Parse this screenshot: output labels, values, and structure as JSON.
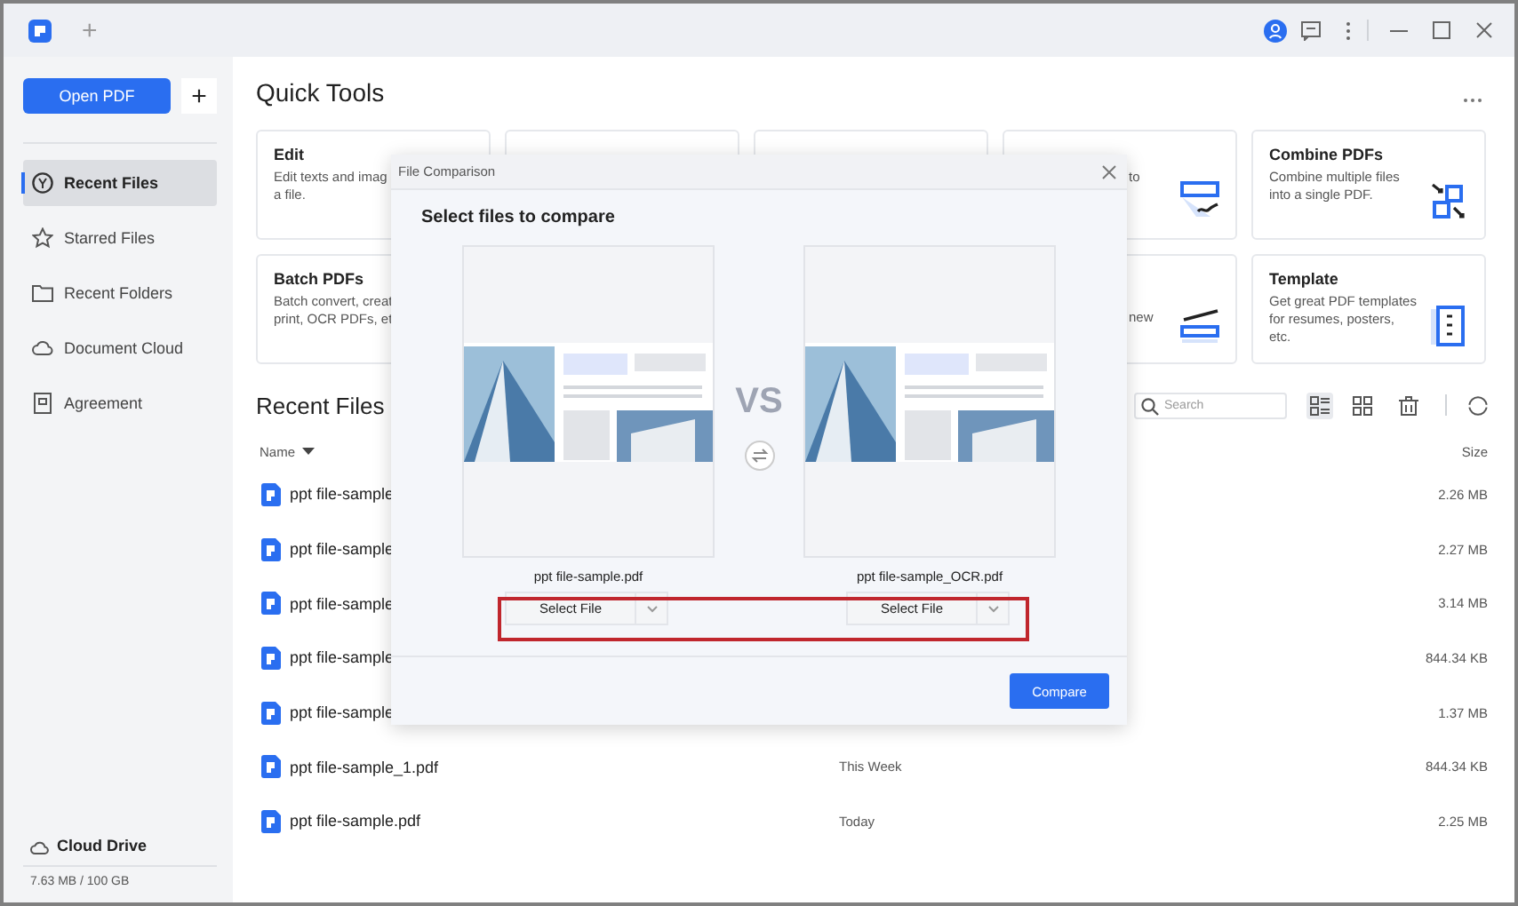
{
  "titlebar": {
    "new_tab": "+"
  },
  "sidebar": {
    "open_button": "Open PDF",
    "add_button": "+",
    "items": [
      {
        "label": "Recent Files",
        "selected": true
      },
      {
        "label": "Starred Files",
        "selected": false
      },
      {
        "label": "Recent Folders",
        "selected": false
      },
      {
        "label": "Document Cloud",
        "selected": false
      },
      {
        "label": "Agreement",
        "selected": false
      }
    ],
    "cloud": {
      "label": "Cloud Drive",
      "usage": "7.63 MB / 100 GB"
    }
  },
  "quick_tools": {
    "title": "Quick Tools",
    "cards": [
      {
        "kind": "full",
        "title": "Edit",
        "desc": "Edit texts and imag\na file."
      },
      {
        "kind": "hidden"
      },
      {
        "kind": "hidden"
      },
      {
        "kind": "tail",
        "desc": "to"
      },
      {
        "kind": "full",
        "title": "Combine PDFs",
        "desc": "Combine multiple files\ninto a single PDF."
      },
      {
        "kind": "full",
        "title": "Batch PDFs",
        "desc": "Batch convert, creat\nprint, OCR PDFs, et"
      },
      {
        "kind": "tail",
        "desc": "new"
      },
      {
        "kind": "full",
        "title": "Template",
        "desc": "Get great PDF templates\nfor resumes, posters,\netc."
      }
    ]
  },
  "recent": {
    "title": "Recent Files",
    "search": {
      "placeholder": "Search"
    },
    "columns": {
      "name": "Name",
      "size": "Size"
    },
    "rows": [
      {
        "name": "ppt file-sample",
        "size": "2.26 MB"
      },
      {
        "name": "ppt file-sample",
        "size": "2.27 MB"
      },
      {
        "name": "ppt file-sample",
        "size": "3.14 MB"
      },
      {
        "name": "ppt file-sample",
        "size": "844.34 KB"
      },
      {
        "name": "ppt file-sample",
        "size": "1.37 MB"
      },
      {
        "name": "ppt file-sample_1.pdf",
        "date": "This Week",
        "size": "844.34 KB"
      },
      {
        "name": "ppt file-sample.pdf",
        "date": "Today",
        "size": "2.25 MB"
      }
    ]
  },
  "dialog": {
    "title": "File Comparison",
    "heading": "Select files to compare",
    "vs": "VS",
    "files": [
      {
        "filename": "ppt file-sample.pdf",
        "button": "Select File"
      },
      {
        "filename": "ppt file-sample_OCR.pdf",
        "button": "Select File"
      }
    ],
    "compare_button": "Compare"
  }
}
